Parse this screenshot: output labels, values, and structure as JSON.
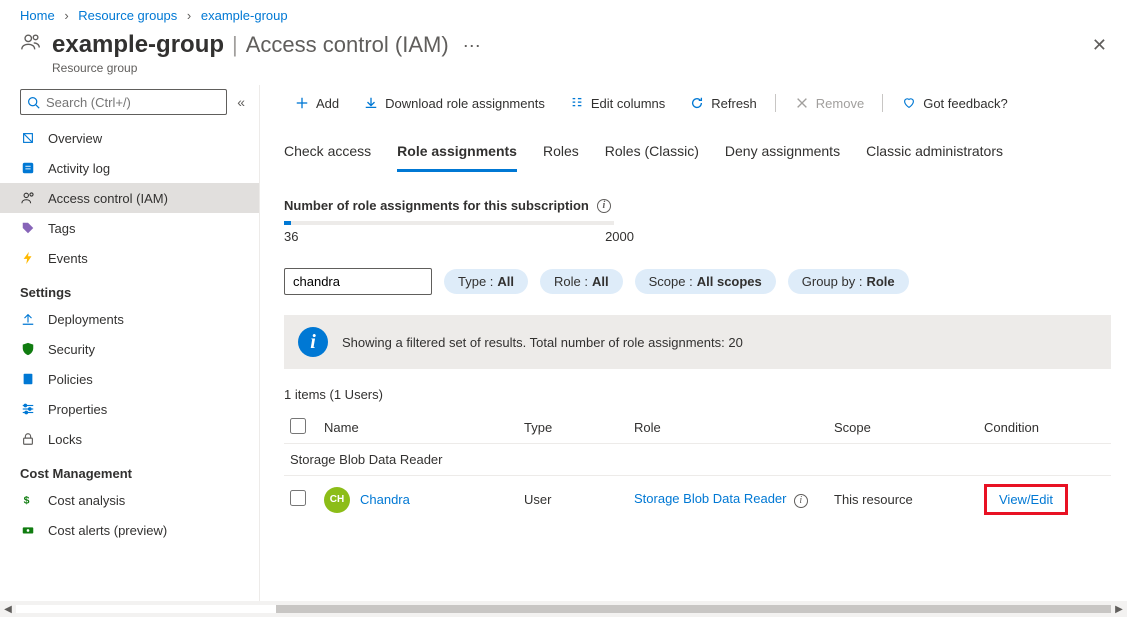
{
  "breadcrumb": {
    "home": "Home",
    "rg": "Resource groups",
    "group": "example-group"
  },
  "header": {
    "title": "example-group",
    "page": "Access control (IAM)",
    "subtitle": "Resource group"
  },
  "search": {
    "placeholder": "Search (Ctrl+/)"
  },
  "sidebar": {
    "items": [
      {
        "label": "Overview"
      },
      {
        "label": "Activity log"
      },
      {
        "label": "Access control (IAM)"
      },
      {
        "label": "Tags"
      },
      {
        "label": "Events"
      }
    ],
    "settings_heading": "Settings",
    "settings": [
      {
        "label": "Deployments"
      },
      {
        "label": "Security"
      },
      {
        "label": "Policies"
      },
      {
        "label": "Properties"
      },
      {
        "label": "Locks"
      }
    ],
    "cost_heading": "Cost Management",
    "cost": [
      {
        "label": "Cost analysis"
      },
      {
        "label": "Cost alerts (preview)"
      }
    ]
  },
  "toolbar": {
    "add": "Add",
    "download": "Download role assignments",
    "edit_cols": "Edit columns",
    "refresh": "Refresh",
    "remove": "Remove",
    "feedback": "Got feedback?"
  },
  "tabs": {
    "check": "Check access",
    "role_assign": "Role assignments",
    "roles": "Roles",
    "roles_classic": "Roles (Classic)",
    "deny": "Deny assignments",
    "classic_admin": "Classic administrators"
  },
  "assign": {
    "label": "Number of role assignments for this subscription",
    "current": "36",
    "max": "2000"
  },
  "filters": {
    "text": "chandra",
    "type_label": "Type : ",
    "type_val": "All",
    "role_label": "Role : ",
    "role_val": "All",
    "scope_label": "Scope : ",
    "scope_val": "All scopes",
    "group_label": "Group by : ",
    "group_val": "Role"
  },
  "banner": "Showing a filtered set of results. Total number of role assignments: 20",
  "items_count": "1 items (1 Users)",
  "columns": {
    "name": "Name",
    "type": "Type",
    "role": "Role",
    "scope": "Scope",
    "cond": "Condition"
  },
  "group_header": "Storage Blob Data Reader",
  "row": {
    "avatar": "CH",
    "name": "Chandra",
    "type": "User",
    "role": "Storage Blob Data Reader",
    "scope": "This resource",
    "cond": "View/Edit"
  }
}
